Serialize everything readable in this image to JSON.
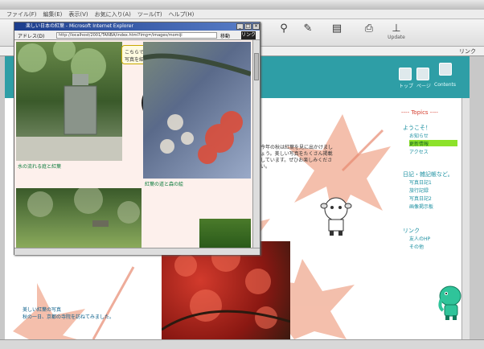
{
  "menu": [
    "ファイル(F)",
    "編集(E)",
    "表示(V)",
    "お気に入り(A)",
    "ツール(T)",
    "ヘルプ(H)"
  ],
  "toolbar": {
    "go_label": "リンク",
    "last_label": "Update"
  },
  "popup": {
    "title": "楽しい日本の紅葉 - Microsoft Internet Explorer",
    "address_label": "アドレス(D)",
    "url": "http://localhost/2001/TANBA/index.html?img=/images/momiji",
    "go_label": "移動",
    "link_label": "リンク",
    "speech": "こちらでは季節の紅葉の写真を紹介しています。",
    "captions": {
      "first": "水の流れる庭と紅葉",
      "second": "紅葉の道と森の絵"
    }
  },
  "page": {
    "body_text": "今年の秋は紅葉を見に出かけましょう。美しい写真をたくさん掲載しています。ぜひお楽しみください。",
    "bottom_caption": "美しい紅葉の写真",
    "bottom_caption2": "秋の一日、京都の寺院を訪ねてみました。",
    "nav": [
      "トップ",
      "ページ",
      "Contents"
    ]
  },
  "sidebar": {
    "heading": "---- Topics ----",
    "sections": [
      {
        "title": "ようこそ！",
        "items": [
          "お知らせ",
          "更新情報",
          "アクセス"
        ]
      },
      {
        "title": "日記・雑記帳など。",
        "items": [
          "写真日記1",
          "旅行記録",
          "写真日記2",
          "画像掲示板"
        ]
      },
      {
        "title": "リンク",
        "items": [
          "友人のHP",
          "その他"
        ]
      }
    ]
  },
  "colors": {
    "banner": "#2e9ea6",
    "accent": "#d43c2c",
    "highlight": "#8de22a"
  }
}
